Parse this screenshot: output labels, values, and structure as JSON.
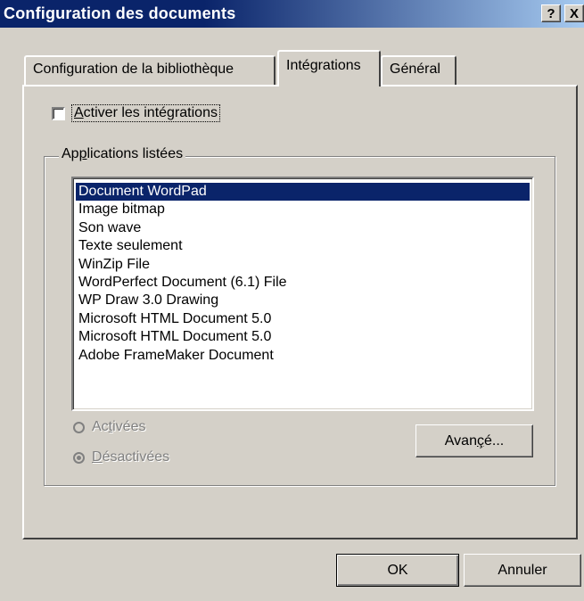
{
  "window": {
    "title": "Configuration des documents",
    "help_label": "?",
    "close_label": "X"
  },
  "tabs": [
    {
      "label": "Configuration de la bibliothèque"
    },
    {
      "label": "Intégrations"
    },
    {
      "label": "Général"
    }
  ],
  "enable_checkbox": {
    "label_prefix": "",
    "label_underline": "A",
    "label_rest": "ctiver les intégrations",
    "checked": false
  },
  "group": {
    "legend_pre": "Ap",
    "legend_u": "p",
    "legend_post": "lications listées"
  },
  "applications": {
    "selected_index": 0,
    "items": [
      "Document WordPad",
      "Image bitmap",
      "Son wave",
      "Texte seulement",
      "WinZip File",
      "WordPerfect Document (6.1) File",
      "WP Draw 3.0 Drawing",
      "Microsoft HTML Document 5.0",
      "Microsoft HTML Document 5.0",
      "Adobe FrameMaker Document"
    ]
  },
  "radio": {
    "activated": {
      "pre": "Ac",
      "u": "t",
      "post": "ivées",
      "checked": false
    },
    "deactivated": {
      "pre": "",
      "u": "D",
      "post": "ésactivées",
      "checked": true
    }
  },
  "buttons": {
    "advanced": {
      "pre": "Avan",
      "u": "ç",
      "post": "é..."
    },
    "ok": "OK",
    "cancel": "Annuler"
  },
  "colors": {
    "title_bar": "#0a246a",
    "selection": "#0a246a",
    "face": "#d4d0c8"
  }
}
